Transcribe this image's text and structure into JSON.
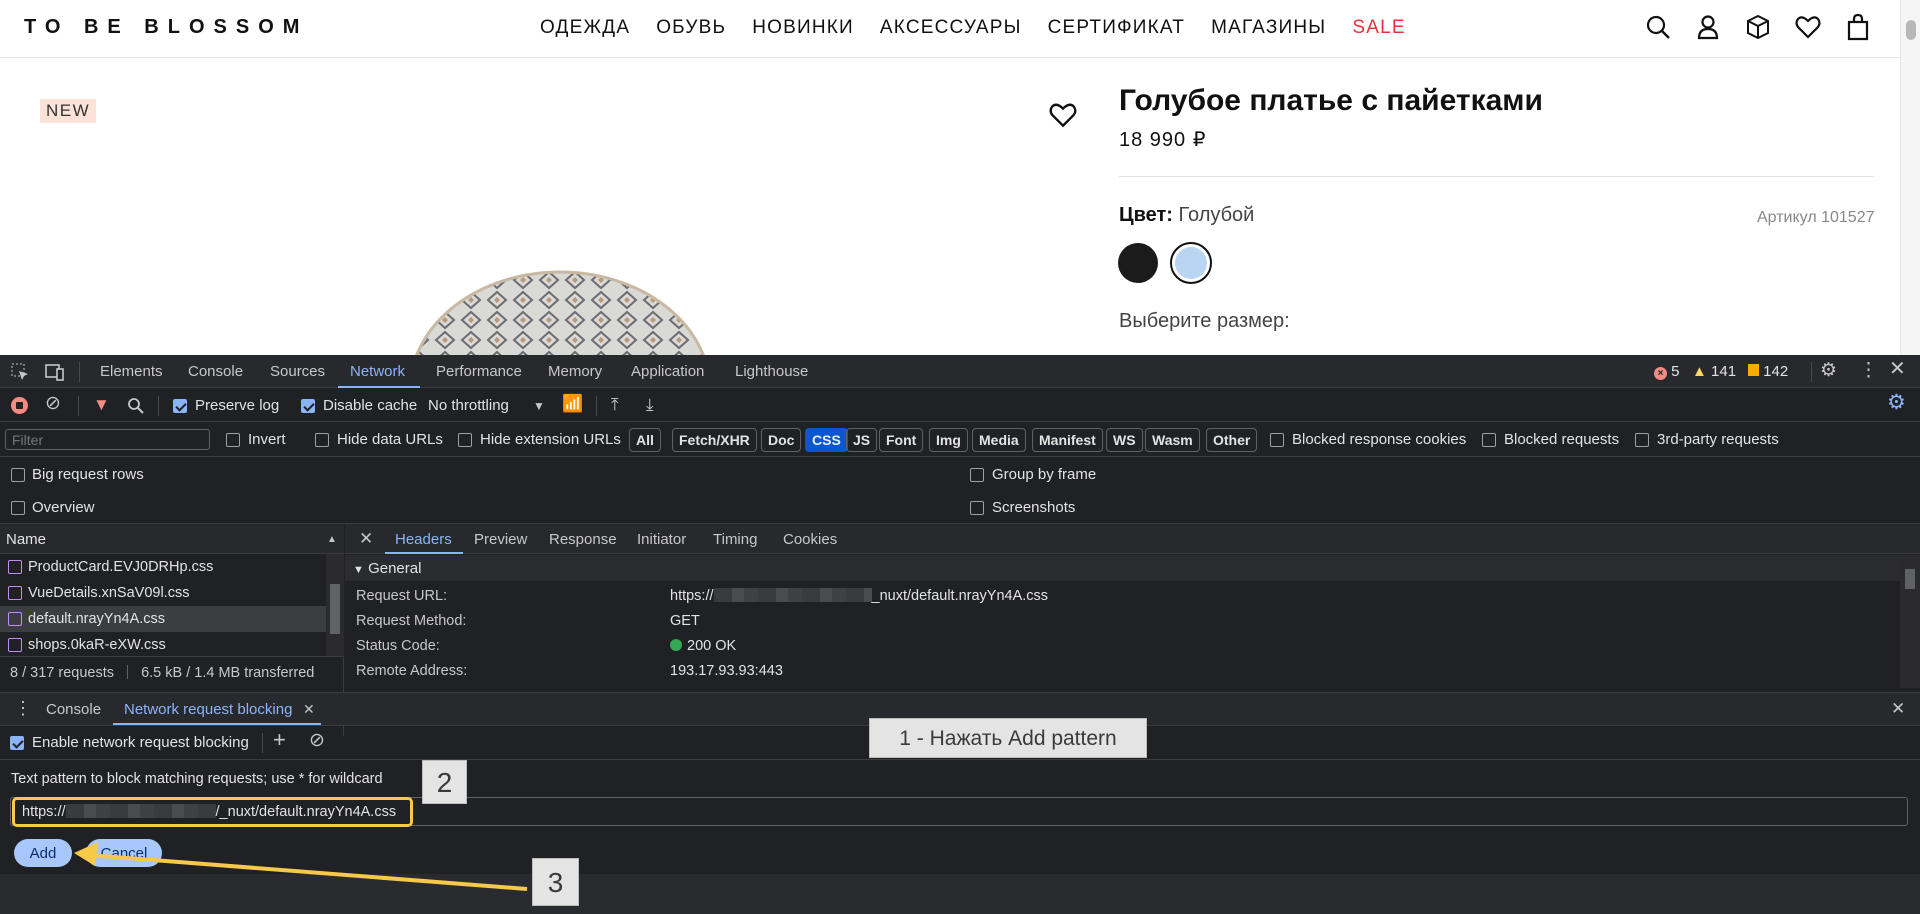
{
  "site": {
    "logo": "TO BE BLOSSOM",
    "nav": [
      "ОДЕЖДА",
      "ОБУВЬ",
      "НОВИНКИ",
      "АКСЕССУАРЫ",
      "СЕРТИФИКАТ",
      "МАГАЗИНЫ",
      "SALE"
    ],
    "header_icons": [
      "search-icon",
      "user-icon",
      "box-icon",
      "heart-icon",
      "bag-icon"
    ]
  },
  "product": {
    "badge": "NEW",
    "title": "Голубое платье с пайетками",
    "price": "18 990 ₽",
    "color_label": "Цвет:",
    "color_value": "Голубой",
    "article": "Артикул 101527",
    "size_prompt": "Выберите размер:",
    "swatches": [
      "#1b1b1b",
      "#b9d5f1"
    ]
  },
  "devtools": {
    "tabs": [
      "Elements",
      "Console",
      "Sources",
      "Network",
      "Performance",
      "Memory",
      "Application",
      "Lighthouse"
    ],
    "active_tab": "Network",
    "errors": "5",
    "warnings": "141",
    "issues": "142",
    "toolbar": {
      "preserve_log": "Preserve log",
      "disable_cache": "Disable cache",
      "throttling": "No throttling"
    },
    "filter": {
      "placeholder": "Filter",
      "invert": "Invert",
      "hide_data_urls": "Hide data URLs",
      "hide_extension_urls": "Hide extension URLs",
      "types": [
        "All",
        "Fetch/XHR",
        "Doc",
        "CSS",
        "JS",
        "Font",
        "Img",
        "Media",
        "Manifest",
        "WS",
        "Wasm",
        "Other"
      ],
      "active_type": "CSS",
      "blocked_response_cookies": "Blocked response cookies",
      "blocked_requests": "Blocked requests",
      "third_party": "3rd-party requests"
    },
    "settings": {
      "big_request_rows": "Big request rows",
      "group_by_frame": "Group by frame",
      "overview": "Overview",
      "screenshots": "Screenshots"
    },
    "requests": {
      "name_header": "Name",
      "items": [
        "ProductCard.EVJ0DRHp.css",
        "VueDetails.xnSaV09l.css",
        "default.nrayYn4A.css",
        "shops.0kaR-eXW.css"
      ],
      "selected": "default.nrayYn4A.css",
      "summary": "8 / 317 requests",
      "transferred": "6.5 kB / 1.4 MB transferred"
    },
    "detail": {
      "tabs": [
        "Headers",
        "Preview",
        "Response",
        "Initiator",
        "Timing",
        "Cookies"
      ],
      "active_tab": "Headers",
      "section": "General",
      "rows": [
        {
          "key": "Request URL:",
          "prefix": "https://",
          "suffix": "_nuxt/default.nrayYn4A.css"
        },
        {
          "key": "Request Method:",
          "value": "GET"
        },
        {
          "key": "Status Code:",
          "value": "200 OK"
        },
        {
          "key": "Remote Address:",
          "value": "193.17.93.93:443"
        }
      ]
    },
    "drawer": {
      "tabs": [
        "Console",
        "Network request blocking"
      ],
      "active_tab": "Network request blocking",
      "enable_blocking": "Enable network request blocking",
      "pattern_hint": "Text pattern to block matching requests; use * for wildcard",
      "pattern_prefix": "https://",
      "pattern_suffix": "/_nuxt/default.nrayYn4A.css",
      "add": "Add",
      "cancel": "Cancel"
    }
  },
  "annotations": {
    "step1": "1 - Нажать Add pattern",
    "step2": "2",
    "step3": "3",
    "highlight_color": "#f6c94a"
  }
}
